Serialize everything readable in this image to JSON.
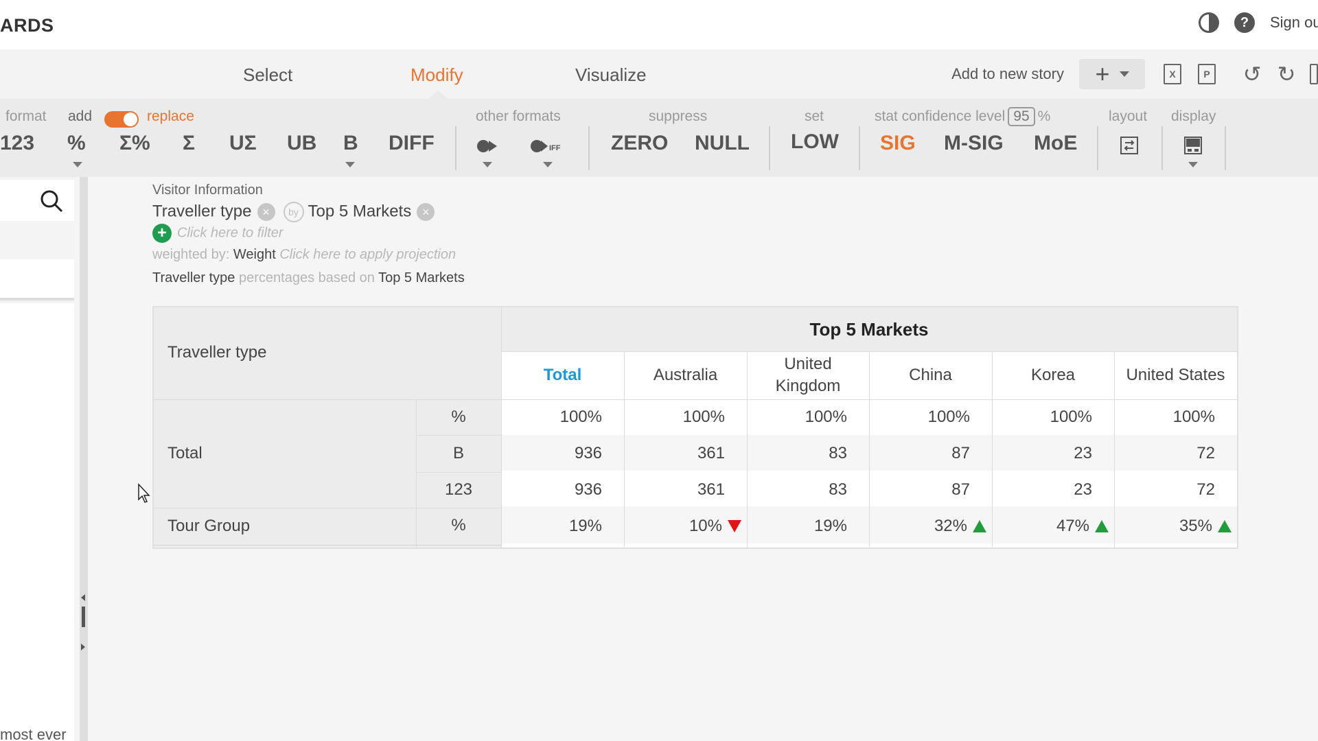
{
  "header": {
    "brand": "ARDS",
    "signout_label": "Sign ou",
    "icons": [
      "contrast-icon",
      "help-icon"
    ]
  },
  "nav": {
    "tabs": [
      {
        "label": "Select",
        "active": false
      },
      {
        "label": "Modify",
        "active": true
      },
      {
        "label": "Visualize",
        "active": false
      }
    ],
    "story_label": "Add to new story"
  },
  "toolbar": {
    "format_label": "format",
    "add_label": "add",
    "replace_label": "replace",
    "other_formats_label": "other formats",
    "suppress_label": "suppress",
    "set_label": "set",
    "stat_label": "stat confidence level",
    "confidence_value": "95",
    "percent_sign": "%",
    "layout_label": "layout",
    "display_label": "display",
    "format_buttons": [
      "123",
      "%",
      "Σ%",
      "Σ",
      "UΣ",
      "UB",
      "B",
      "DIFF"
    ],
    "suppress_buttons": [
      "ZERO",
      "NULL"
    ],
    "set_buttons": [
      "LOW"
    ],
    "stat_buttons": [
      "SIG",
      "M-SIG",
      "MoE"
    ],
    "accent_color": "#e8742f"
  },
  "sidebar": {
    "bottom_text": "most ever"
  },
  "query": {
    "dataset": "Visitor Information",
    "row_variable": "Traveller type",
    "by_label": "by",
    "column_variable": "Top 5 Markets",
    "filter_placeholder": "Click here to filter",
    "weighted_prefix": "weighted by:",
    "weight_name": "Weight",
    "projection_placeholder": "Click here to apply projection",
    "base_row_var": "Traveller type",
    "base_text": "percentages based on",
    "base_col_var": "Top 5 Markets"
  },
  "table": {
    "row_header": "Traveller type",
    "column_group": "Top 5 Markets",
    "columns": [
      "Total",
      "Australia",
      "United Kingdom",
      "China",
      "Korea",
      "United States"
    ],
    "total_label": "Total",
    "rows": [
      {
        "label": "Total",
        "stat": "%",
        "values": [
          "100%",
          "100%",
          "100%",
          "100%",
          "100%",
          "100%"
        ],
        "sig": [
          "",
          "",
          "",
          "",
          "",
          ""
        ]
      },
      {
        "label": "",
        "stat": "B",
        "values": [
          "936",
          "361",
          "83",
          "87",
          "23",
          "72"
        ],
        "sig": [
          "",
          "",
          "",
          "",
          "",
          ""
        ]
      },
      {
        "label": "",
        "stat": "123",
        "values": [
          "936",
          "361",
          "83",
          "87",
          "23",
          "72"
        ],
        "sig": [
          "",
          "",
          "",
          "",
          "",
          ""
        ]
      },
      {
        "label": "Tour Group",
        "stat": "%",
        "values": [
          "19%",
          "10%",
          "19%",
          "32%",
          "47%",
          "35%"
        ],
        "sig": [
          "",
          "down",
          "",
          "up",
          "up",
          "up"
        ]
      }
    ],
    "total_color": "#1a9ad6",
    "sig_down_color": "#e41313",
    "sig_up_color": "#1f9e3a"
  }
}
